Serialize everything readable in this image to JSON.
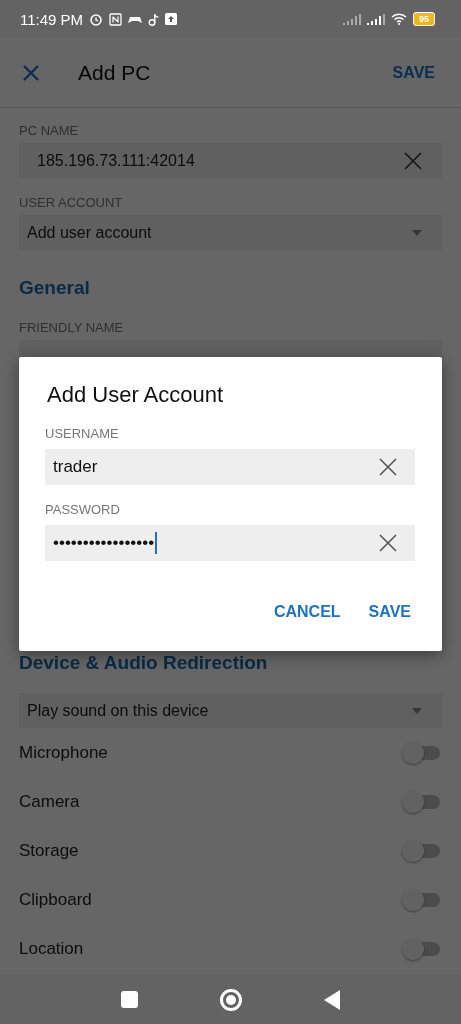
{
  "status_bar": {
    "time": "11:49 PM",
    "battery": "95"
  },
  "app_bar": {
    "title": "Add PC",
    "action": "SAVE"
  },
  "pc_name": {
    "label": "PC NAME",
    "value": "185.196.73.111:42014"
  },
  "user_account": {
    "label": "USER ACCOUNT",
    "value": "Add user account"
  },
  "general": {
    "heading": "General",
    "friendly_name": {
      "label": "FRIENDLY NAME"
    }
  },
  "device_audio": {
    "heading": "Device & Audio Redirection",
    "sound": "Play sound on this device",
    "toggles": [
      {
        "label": "Microphone",
        "on": false
      },
      {
        "label": "Camera",
        "on": false
      },
      {
        "label": "Storage",
        "on": false
      },
      {
        "label": "Clipboard",
        "on": false
      },
      {
        "label": "Location",
        "on": false
      }
    ]
  },
  "dialog": {
    "title": "Add User Account",
    "fields": [
      {
        "label": "USERNAME",
        "value": "trader",
        "focused": false
      },
      {
        "label": "PASSWORD",
        "value": "•••••••••••••••••",
        "focused": true
      }
    ],
    "buttons": [
      "CANCEL",
      "SAVE"
    ]
  }
}
